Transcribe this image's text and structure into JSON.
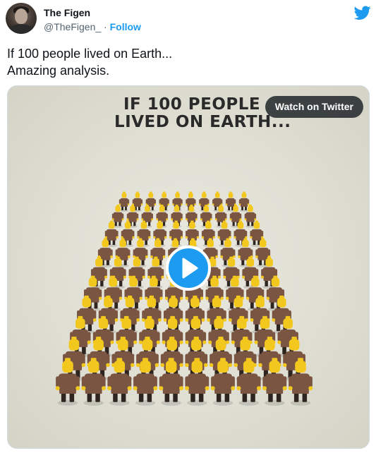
{
  "author": {
    "name": "The Figen",
    "handle": "@TheFigen_",
    "separator": " · ",
    "follow_label": "Follow"
  },
  "tweet": {
    "line1": "If 100 people lived on Earth...",
    "line2": "Amazing analysis."
  },
  "media": {
    "title_line1": "IF 100 PEOPLE",
    "title_line2": "LIVED ON EARTH...",
    "watch_label": "Watch on Twitter",
    "figure_count": 100
  },
  "icons": {
    "logo": "twitter-bird-icon",
    "play": "play-icon"
  },
  "colors": {
    "accent": "#1d9bf0",
    "figure_head": "#f2c81f",
    "figure_shirt": "#7a5542",
    "background": "#dfded3"
  }
}
